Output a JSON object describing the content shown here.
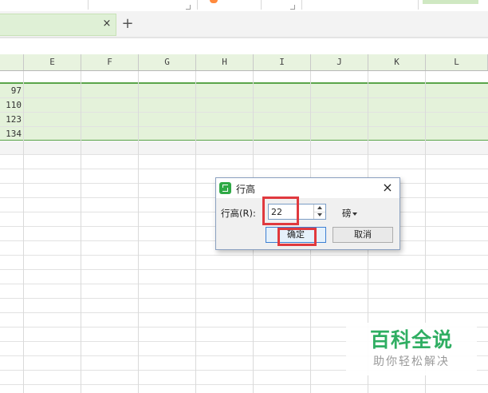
{
  "tab": {
    "close_glyph": "×",
    "new_glyph": "+"
  },
  "columns": [
    "E",
    "F",
    "G",
    "H",
    "I",
    "J",
    "K",
    "L"
  ],
  "rows": [
    {
      "value": "97"
    },
    {
      "value": "110"
    },
    {
      "value": "123"
    },
    {
      "value": "134"
    }
  ],
  "dialog": {
    "title": "行高",
    "close_glyph": "×",
    "field_label": "行高(R):",
    "field_value": "22",
    "unit": "磅",
    "ok_label": "确定",
    "cancel_label": "取消"
  },
  "watermark": {
    "title": "百科全说",
    "subtitle": "助你轻松解决"
  },
  "colors": {
    "accent_green": "#5aa54a",
    "highlight_red": "#e0393e",
    "app_icon": "#2fa946"
  }
}
